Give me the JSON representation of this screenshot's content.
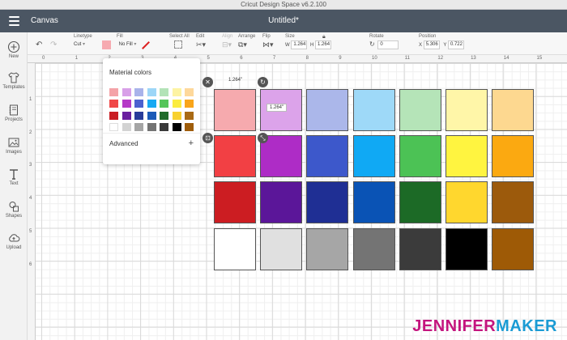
{
  "window": {
    "title": "Cricut Design Space  v6.2.100"
  },
  "header": {
    "canvas_label": "Canvas",
    "doc_title": "Untitled*"
  },
  "sidebar": {
    "items": [
      {
        "label": "New",
        "icon": "plus-circle-icon"
      },
      {
        "label": "Templates",
        "icon": "shirt-icon"
      },
      {
        "label": "Projects",
        "icon": "notebook-icon"
      },
      {
        "label": "Images",
        "icon": "image-icon"
      },
      {
        "label": "Text",
        "icon": "text-t-icon"
      },
      {
        "label": "Shapes",
        "icon": "shapes-icon"
      },
      {
        "label": "Upload",
        "icon": "cloud-upload-icon"
      }
    ]
  },
  "toolbar": {
    "linetype_label": "Linetype",
    "linetype_value": "Cut",
    "fill_label": "Fill",
    "fill_value": "No Fill",
    "fill_swatch_color": "#f6aab0",
    "select_all_label": "Select All",
    "edit_label": "Edit",
    "align_label": "Align",
    "arrange_label": "Arrange",
    "flip_label": "Flip",
    "size_label": "Size",
    "w_label": "W",
    "w_value": "1.264",
    "h_label": "H",
    "h_value": "1.264",
    "rotate_label": "Rotate",
    "rotate_value": "0",
    "position_label": "Position",
    "x_label": "X",
    "x_value": "5.306",
    "y_label": "Y",
    "y_value": "0.722"
  },
  "rulers": {
    "top": [
      "0",
      "1",
      "2",
      "3",
      "4",
      "5",
      "6",
      "7",
      "8",
      "9",
      "10",
      "11",
      "12",
      "13",
      "14",
      "15"
    ],
    "left": [
      "1",
      "2",
      "3",
      "4",
      "5",
      "6"
    ]
  },
  "panel": {
    "title": "Material colors",
    "advanced_label": "Advanced",
    "plus": "+",
    "rows": [
      [
        "#f4a3a8",
        "#d8a0e8",
        "#a9b3ea",
        "#9dd6f7",
        "#b3e3b7",
        "#fdf3a3",
        "#fed89b"
      ],
      [
        "#f04848",
        "#b53ac7",
        "#4c61cf",
        "#18a9f2",
        "#55c55a",
        "#fbec40",
        "#f9a51a"
      ],
      [
        "#c91d23",
        "#6a1fa0",
        "#283c9a",
        "#1b5bb8",
        "#1f6b2a",
        "#f8d12f",
        "#a96a14"
      ],
      [
        "#ffffff",
        "#d3d3d3",
        "#a5a5a5",
        "#737373",
        "#3a3a3a",
        "#000000",
        "#9f5d0b"
      ]
    ]
  },
  "selection": {
    "width_tag": "1.264\"",
    "height_tag": "1.264\""
  },
  "swatches": {
    "rows": [
      [
        "#f6aaae",
        "#dca3ea",
        "#abb7ea",
        "#9ed9f8",
        "#b5e4b8",
        "#fff6a8",
        "#fdd890"
      ],
      [
        "#f24044",
        "#ae2cc6",
        "#3d58cb",
        "#10a9f4",
        "#4cc255",
        "#fff440",
        "#fba911"
      ],
      [
        "#cc1d22",
        "#5b1699",
        "#1f2f94",
        "#0a53b5",
        "#1c6a26",
        "#ffd72e",
        "#9c5a0c"
      ],
      [
        "#ffffff",
        "#e0e0e0",
        "#a6a6a6",
        "#747474",
        "#3b3b3b",
        "#000000",
        "#9e5a06"
      ]
    ]
  },
  "watermark": {
    "part1": "JENNIFER",
    "part2": "MAKER",
    "color1": "#c4157e",
    "color2": "#1a9bd4"
  }
}
